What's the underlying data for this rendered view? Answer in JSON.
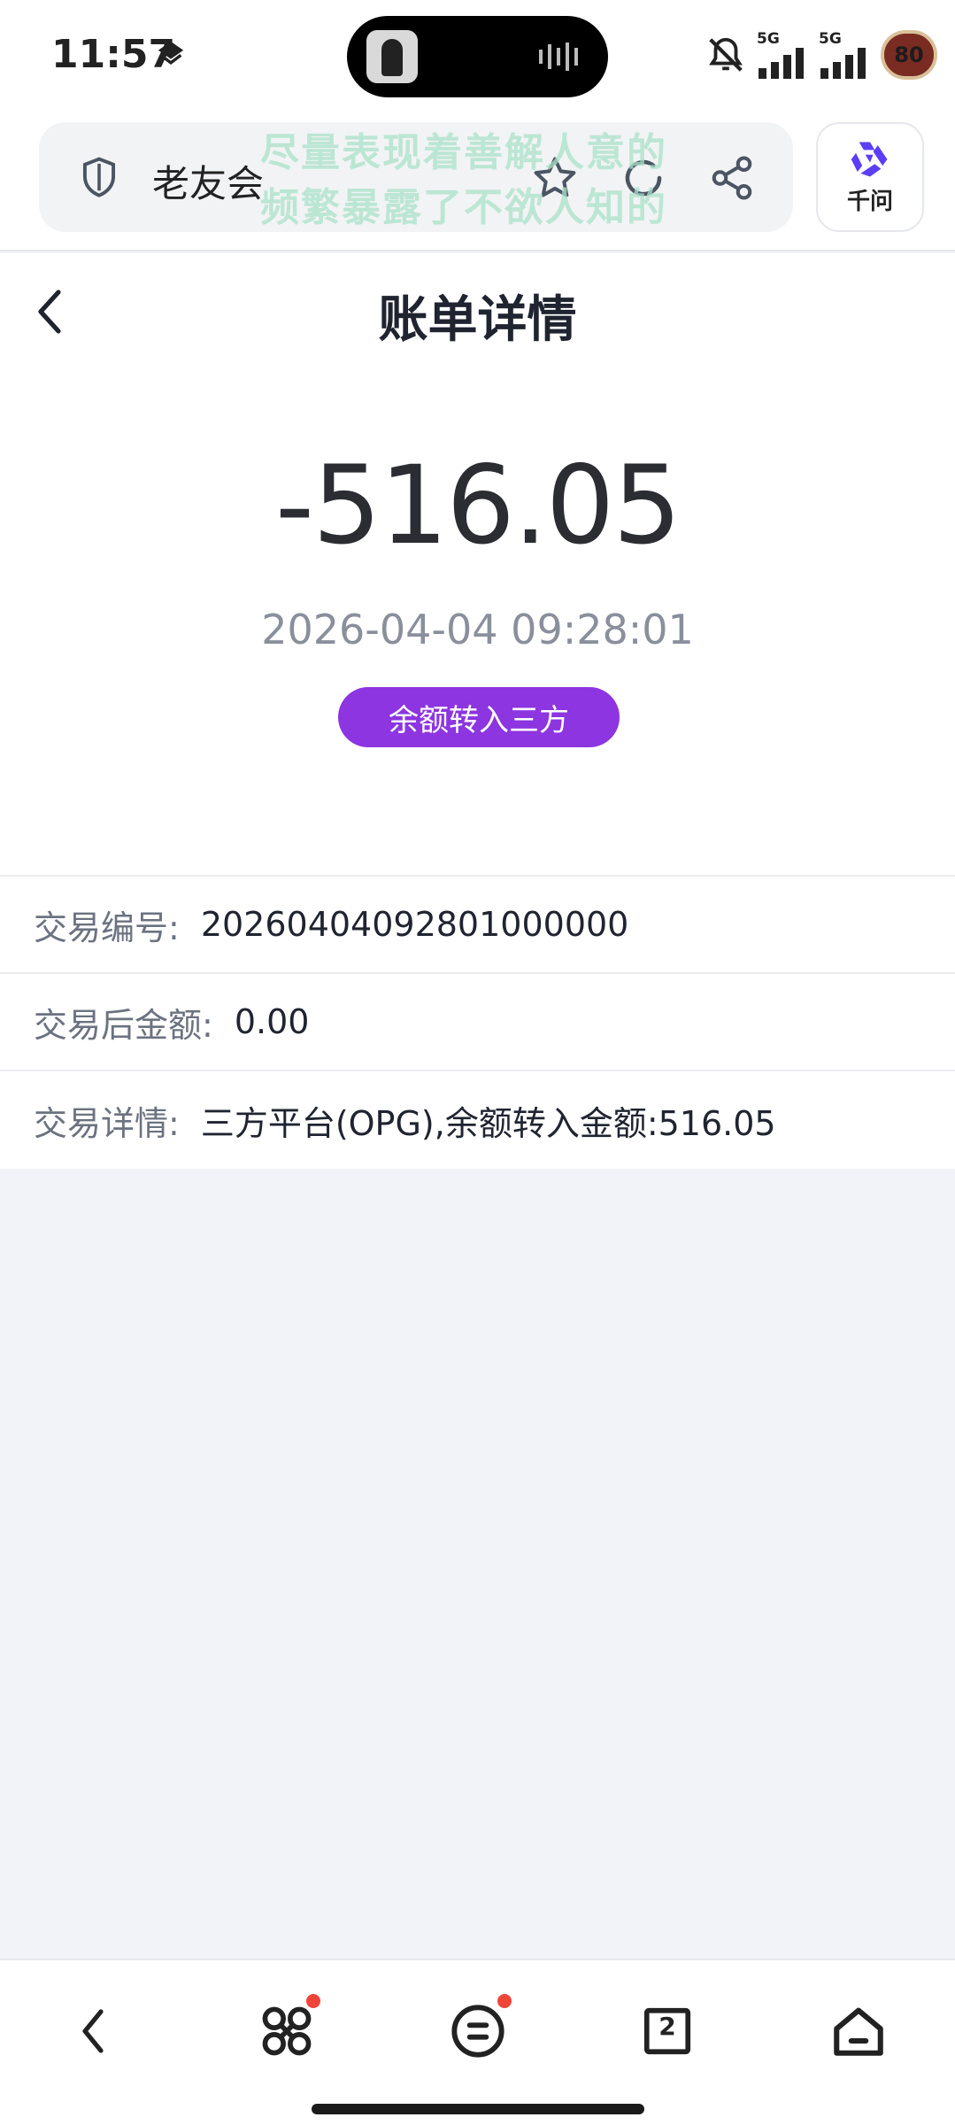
{
  "status_bar": {
    "time": "11:57",
    "signal_1": "5G",
    "signal_2": "5G",
    "battery": "80"
  },
  "browser": {
    "site_title": "老友会",
    "watermark_line_1": "尽量表现着善解人意的",
    "watermark_line_2": "频繁暴露了不欲人知的",
    "ai_label": "千问"
  },
  "page": {
    "title": "账单详情"
  },
  "transaction": {
    "amount": "-516.05",
    "datetime": "2026-04-04 09:28:01",
    "type_badge": "余额转入三方",
    "rows": [
      {
        "label": "交易编号:",
        "value": "20260404092801000000"
      },
      {
        "label": "交易后金额:",
        "value": "0.00"
      },
      {
        "label": "交易详情:",
        "value": "三方平台(OPG),余额转入金额:516.05"
      }
    ]
  },
  "bottom_nav": {
    "tab_count": "2"
  },
  "colors": {
    "accent": "#8c35e0",
    "background": "#f2f3f8",
    "ai_logo": "#5b3ef5",
    "notification_dot": "#f04438"
  }
}
